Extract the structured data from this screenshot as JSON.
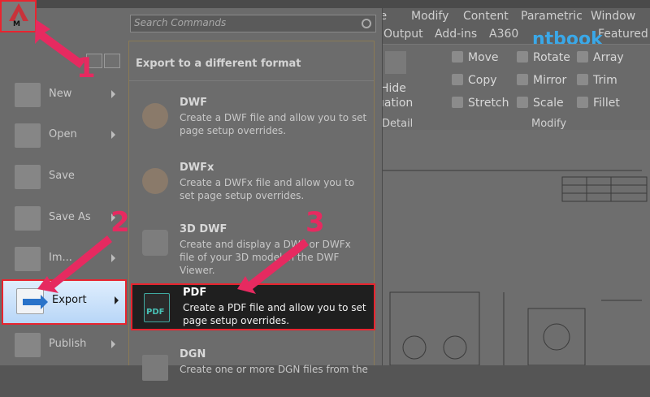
{
  "app_button": {
    "letter": "M"
  },
  "search": {
    "placeholder": "Search Commands"
  },
  "menubar": [
    "te",
    "Modify",
    "Content",
    "Parametric",
    "Window"
  ],
  "ribbon_tabs": [
    "Output",
    "Add-ins",
    "A360",
    "Featured"
  ],
  "ribbon_tools": {
    "move": "Move",
    "rotate": "Rotate",
    "array": "Array",
    "copy": "Copy",
    "mirror": "Mirror",
    "trim": "Trim",
    "stretch": "Stretch",
    "scale": "Scale",
    "fillet": "Fillet",
    "hide": "Hide",
    "uation": "uation"
  },
  "panel_labels": {
    "detail": "Detail",
    "modify": "Modify"
  },
  "logo": "ntbook",
  "left_menu": [
    {
      "label": "New",
      "has_arrow": true
    },
    {
      "label": "Open",
      "has_arrow": true
    },
    {
      "label": "Save",
      "has_arrow": false
    },
    {
      "label": "Save As",
      "has_arrow": true
    },
    {
      "label": "Im...",
      "has_arrow": true
    },
    {
      "label": "Export",
      "has_arrow": true,
      "selected": true
    },
    {
      "label": "Publish",
      "has_arrow": true
    }
  ],
  "submenu": {
    "header": "Export to a different format",
    "formats": [
      {
        "title": "DWF",
        "description": "Create a DWF file and allow you to set page setup overrides."
      },
      {
        "title": "DWFx",
        "description": "Create a DWFx file and allow you to set page setup overrides."
      },
      {
        "title": "3D DWF",
        "description": "Create and display a DWF or DWFx file of your 3D model in the DWF Viewer."
      },
      {
        "title": "PDF",
        "description": "Create a PDF file and allow you to set page setup overrides.",
        "icon_text": "PDF",
        "selected": true
      },
      {
        "title": "DGN",
        "description": "Create one or more DGN files from the"
      }
    ]
  },
  "callouts": [
    "1",
    "2",
    "3"
  ],
  "colors": {
    "highlight_border": "#e8242f",
    "callout": "#e62a60",
    "export_bg": "#cfe3fa",
    "logo": "#3aa8e8"
  }
}
